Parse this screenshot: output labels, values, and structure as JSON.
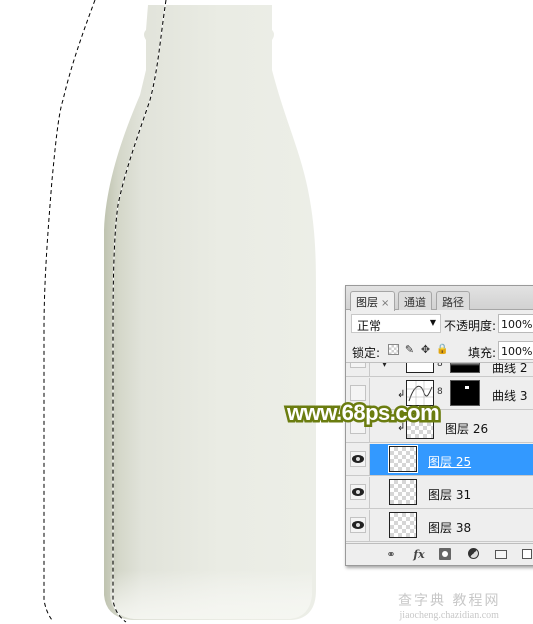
{
  "app": "Photoshop",
  "canvas": {
    "subject": "milk-bottle",
    "bottle_colors": {
      "body_light": "#eceee7",
      "body_mid": "#e2e4db",
      "edge_shadow": "#c4c7b6"
    },
    "selection": "marching-ants"
  },
  "layers_panel": {
    "tabs": [
      {
        "label": "图层",
        "close": "×",
        "active": true
      },
      {
        "label": "通道",
        "active": false
      },
      {
        "label": "路径",
        "active": false
      }
    ],
    "blend_mode": "正常",
    "opacity_label": "不透明度:",
    "opacity_value": "100%",
    "lock_label": "锁定:",
    "fill_label": "填充:",
    "fill_value": "100%",
    "layers": [
      {
        "name": "曲线 2",
        "type": "adjustment",
        "visible": false,
        "clipped": false,
        "selected": false,
        "partial": true
      },
      {
        "name": "曲线 3",
        "type": "adjustment",
        "visible": false,
        "clipped": true,
        "selected": false
      },
      {
        "name": "图层 26",
        "type": "pixel",
        "visible": false,
        "clipped": true,
        "selected": false
      },
      {
        "name": "图层 25",
        "type": "pixel",
        "visible": true,
        "clipped": false,
        "selected": true
      },
      {
        "name": "图层 31",
        "type": "pixel",
        "visible": true,
        "clipped": false,
        "selected": false
      },
      {
        "name": "图层 38",
        "type": "pixel",
        "visible": true,
        "clipped": false,
        "selected": false
      }
    ],
    "bottom_tools": [
      "link-layers",
      "fx",
      "add-mask",
      "adjustment-layer",
      "new-group",
      "new-layer"
    ],
    "fx_label": "fx",
    "selected_color": "#3399ff"
  },
  "watermarks": {
    "site": "www.68ps.com",
    "site_color": "#6b7d10",
    "chazidian_cn": "查字典 教程网",
    "chazidian_url": "jiaocheng.chazidian.com"
  }
}
